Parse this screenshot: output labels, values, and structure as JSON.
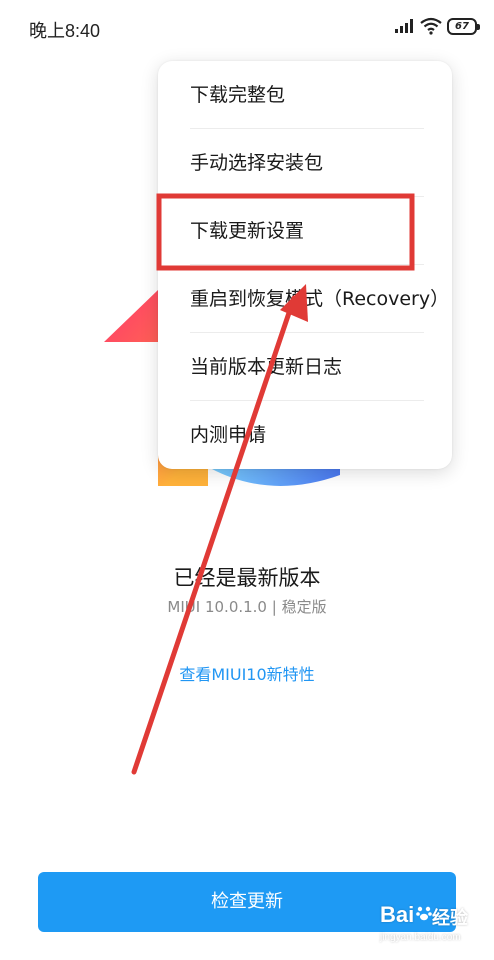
{
  "status_bar": {
    "time": "晚上8:40",
    "battery": "67",
    "icons": [
      "signal-icon",
      "wifi-icon",
      "battery-icon"
    ]
  },
  "menu": {
    "items": [
      {
        "label": "下载完整包"
      },
      {
        "label": "手动选择安装包"
      },
      {
        "label": "下载更新设置"
      },
      {
        "label": "重启到恢复模式（Recovery）"
      },
      {
        "label": "当前版本更新日志"
      },
      {
        "label": "内测申请"
      }
    ],
    "highlighted_index": 2
  },
  "main": {
    "status_title": "已经是最新版本",
    "version": "MIUI 10.0.1.0 | 稳定版",
    "features_link": "查看MIUI10新特性"
  },
  "check_button": {
    "label": "检查更新"
  },
  "watermark": {
    "brand": "Bai",
    "brand_cn": "经验",
    "url": "jingyan.baidu.com"
  },
  "colors": {
    "accent": "#1e9af4",
    "link": "#2196f3",
    "annotation": "#e03a36"
  }
}
